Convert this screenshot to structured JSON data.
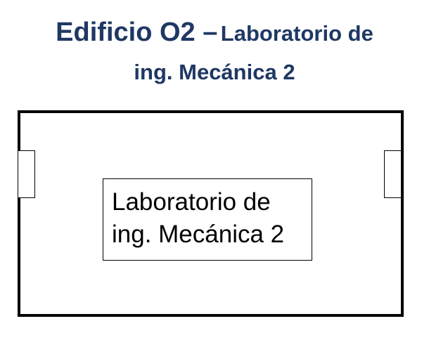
{
  "title": {
    "main": "Edificio O2 –",
    "sub": "Laboratorio de",
    "line2": "ing. Mecánica 2"
  },
  "room": {
    "label_line1": "Laboratorio de",
    "label_line2": "ing. Mecánica 2"
  },
  "colors": {
    "title": "#1f3864",
    "lines": "#000000",
    "background": "#ffffff"
  }
}
